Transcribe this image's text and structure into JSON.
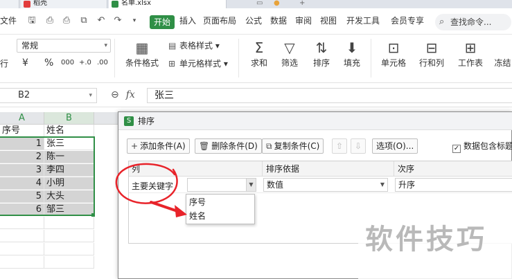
{
  "tabbar": {
    "tab1_label": "稻壳",
    "tab2_label": "名单.xlsx",
    "plus": "+"
  },
  "menu": {
    "file": "文件",
    "start": "开始",
    "items": [
      "插入",
      "页面布局",
      "公式",
      "数据",
      "审阅",
      "视图",
      "开发工具",
      "会员专享"
    ],
    "search_placeholder": "查找命令..."
  },
  "toolbar": {
    "number_format": "常规",
    "currency": "¥",
    "percent": "%",
    "thousands": "000",
    "dec_inc": "+.0",
    "dec_dec": ".00",
    "left_edge": "行",
    "conditional_format": "条件格式",
    "table_style": "表格样式",
    "cell_style": "单元格样式",
    "sum": "求和",
    "filter": "筛选",
    "sort": "排序",
    "fill": "填充",
    "cell": "单元格",
    "row_col": "行和列",
    "worksheet": "工作表",
    "freeze": "冻结"
  },
  "formula_bar": {
    "name_box": "B2",
    "fx": "fx",
    "content": "张三"
  },
  "sheet": {
    "columns": [
      "A",
      "B"
    ],
    "header_row": [
      "序号",
      "姓名"
    ],
    "rows": [
      {
        "num": "1",
        "name": "张三"
      },
      {
        "num": "2",
        "name": "陈一"
      },
      {
        "num": "3",
        "name": "李四"
      },
      {
        "num": "4",
        "name": "小明"
      },
      {
        "num": "5",
        "name": "大头"
      },
      {
        "num": "6",
        "name": "邹三"
      }
    ]
  },
  "dialog": {
    "title": "排序",
    "add_condition": "添加条件(A)",
    "delete_condition": "删除条件(D)",
    "copy_condition": "复制条件(C)",
    "options": "选项(O)...",
    "header_checkbox": "数据包含标题",
    "header_checked": true,
    "col_header": "列",
    "basis_header": "排序依据",
    "order_header": "次序",
    "row_label": "主要关键字",
    "basis_value": "数值",
    "order_value": "升序",
    "dropdown_options": [
      "序号",
      "姓名"
    ]
  },
  "watermark": "软件技巧",
  "colors": {
    "accent": "#2f8f46",
    "annotation_red": "#e8232a"
  }
}
